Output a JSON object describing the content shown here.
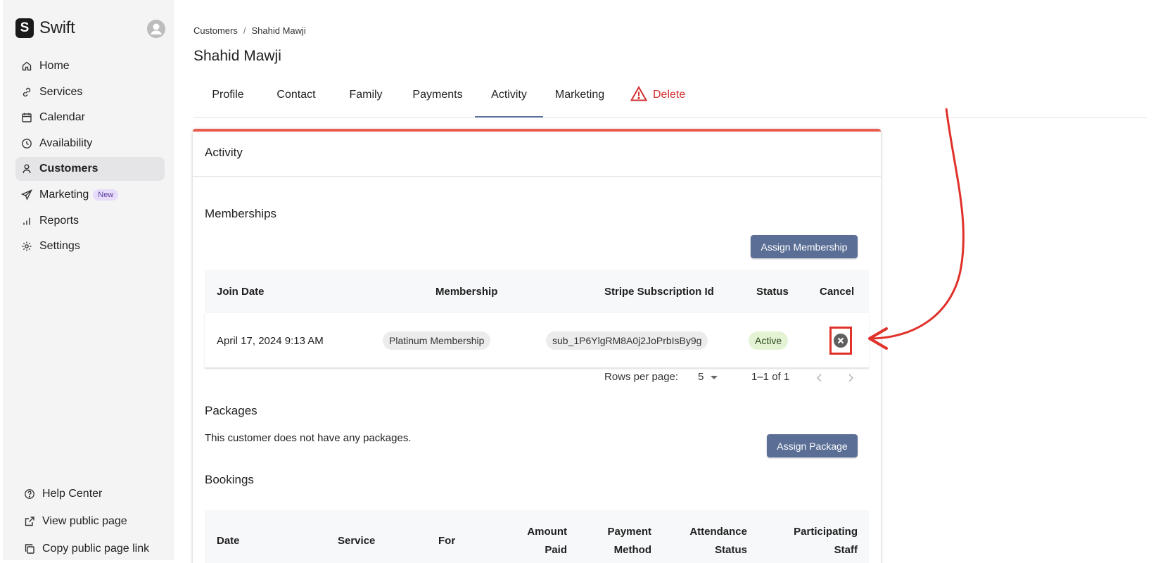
{
  "app": {
    "brand_initial": "S",
    "brand_name": "Swift"
  },
  "sidebar": {
    "items": [
      {
        "label": "Home",
        "icon": "home-icon"
      },
      {
        "label": "Services",
        "icon": "link-icon"
      },
      {
        "label": "Calendar",
        "icon": "calendar-icon"
      },
      {
        "label": "Availability",
        "icon": "clock-icon"
      },
      {
        "label": "Customers",
        "icon": "person-icon",
        "active": true
      },
      {
        "label": "Marketing",
        "icon": "send-icon",
        "badge": "New"
      },
      {
        "label": "Reports",
        "icon": "bar-chart-icon"
      },
      {
        "label": "Settings",
        "icon": "gear-icon"
      }
    ],
    "bottom_items": [
      {
        "label": "Help Center",
        "icon": "help-icon"
      },
      {
        "label": "View public page",
        "icon": "external-link-icon"
      },
      {
        "label": "Copy public page link",
        "icon": "copy-icon"
      }
    ]
  },
  "breadcrumb": {
    "parent": "Customers",
    "separator": "/",
    "current": "Shahid Mawji"
  },
  "page_title": "Shahid Mawji",
  "tabs": {
    "profile": "Profile",
    "contact": "Contact",
    "family": "Family",
    "payments": "Payments",
    "activity": "Activity",
    "marketing": "Marketing",
    "delete": "Delete",
    "active_tab": "Activity"
  },
  "card": {
    "title": "Activity",
    "memberships": {
      "title": "Memberships",
      "assign_button": "Assign Membership",
      "columns": {
        "join_date": "Join Date",
        "membership": "Membership",
        "stripe_id": "Stripe Subscription Id",
        "status": "Status",
        "cancel": "Cancel"
      },
      "rows": [
        {
          "join_date": "April 17, 2024 9:13 AM",
          "membership": "Platinum Membership",
          "stripe_id": "sub_1P6YlgRM8A0j2JoPrbIsBy9g",
          "status": "Active"
        }
      ],
      "pagination": {
        "rows_per_page_label": "Rows per page:",
        "rows_per_page_value": "5",
        "range": "1–1 of 1"
      }
    },
    "packages": {
      "title": "Packages",
      "empty_text": "This customer does not have any packages.",
      "assign_button": "Assign Package"
    },
    "bookings": {
      "title": "Bookings",
      "columns": {
        "date": "Date",
        "service": "Service",
        "for": "For",
        "amount_paid_1": "Amount",
        "amount_paid_2": "Paid",
        "payment_method_1": "Payment",
        "payment_method_2": "Method",
        "attendance_1": "Attendance",
        "attendance_2": "Status",
        "staff_1": "Participating",
        "staff_2": "Staff"
      }
    }
  },
  "colors": {
    "accent": "#5a6e96",
    "card_top_border": "#e85d4f",
    "annotation_red": "#e0312a",
    "delete_red": "#d32f2f",
    "active_chip_bg": "#e3f3d4"
  }
}
